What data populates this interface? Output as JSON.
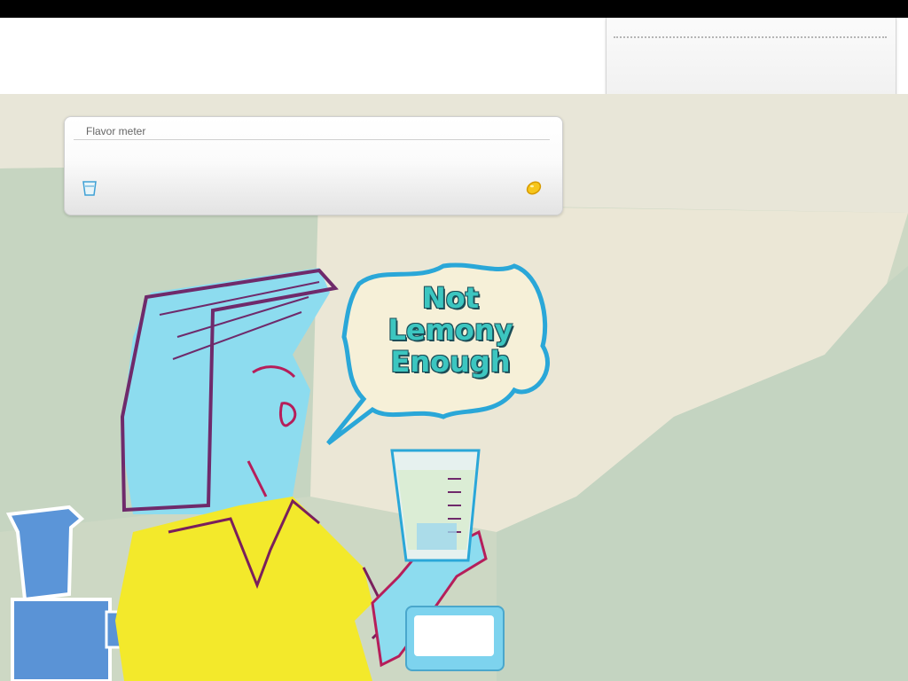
{
  "header": {
    "label": ""
  },
  "side_panel": {
    "label": ""
  },
  "meter": {
    "title": "Flavor meter",
    "left_icon": "cup-icon",
    "right_icon": "lemon-icon",
    "level": 0
  },
  "speech_bubble": {
    "lines": [
      "Not",
      "Lemony",
      "Enough"
    ]
  },
  "counter": {
    "value": ""
  },
  "colors": {
    "bubble_text": "#3cc6c0",
    "bubble_outline": "#2aa7d8",
    "shirt": "#f4ea2a",
    "skin": "#8cdcef",
    "hair_outline": "#7a1f5c"
  }
}
